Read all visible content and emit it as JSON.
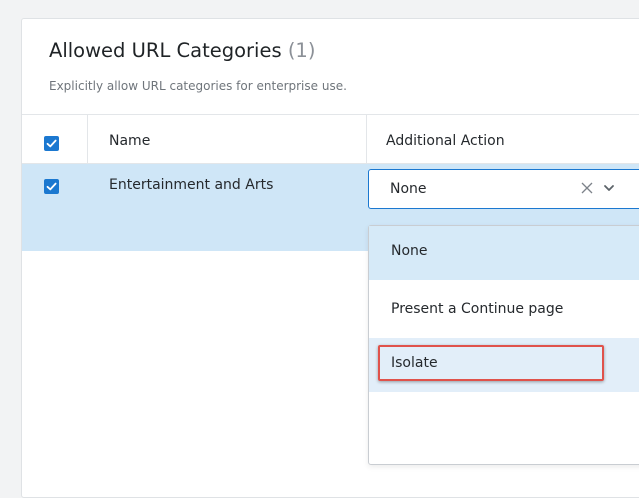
{
  "panel": {
    "title": "Allowed URL Categories",
    "count": "(1)",
    "subtitle": "Explicitly allow URL categories for enterprise use."
  },
  "table": {
    "columns": [
      "Name",
      "Additional Action"
    ],
    "header_checked": true,
    "rows": [
      {
        "checked": true,
        "name": "Entertainment and Arts",
        "action": "None"
      }
    ]
  },
  "dropdown": {
    "value": "None",
    "options": [
      "None",
      "Present a Continue page",
      "Isolate"
    ],
    "selected_option": "None",
    "highlighted_option": "Isolate"
  },
  "colors": {
    "accent": "#1b78d0",
    "row_selected": "#cfe6f7",
    "annotation": "#e0524b"
  },
  "icons": [
    "checkbox-checked-icon",
    "clear-icon",
    "chevron-down-icon"
  ]
}
